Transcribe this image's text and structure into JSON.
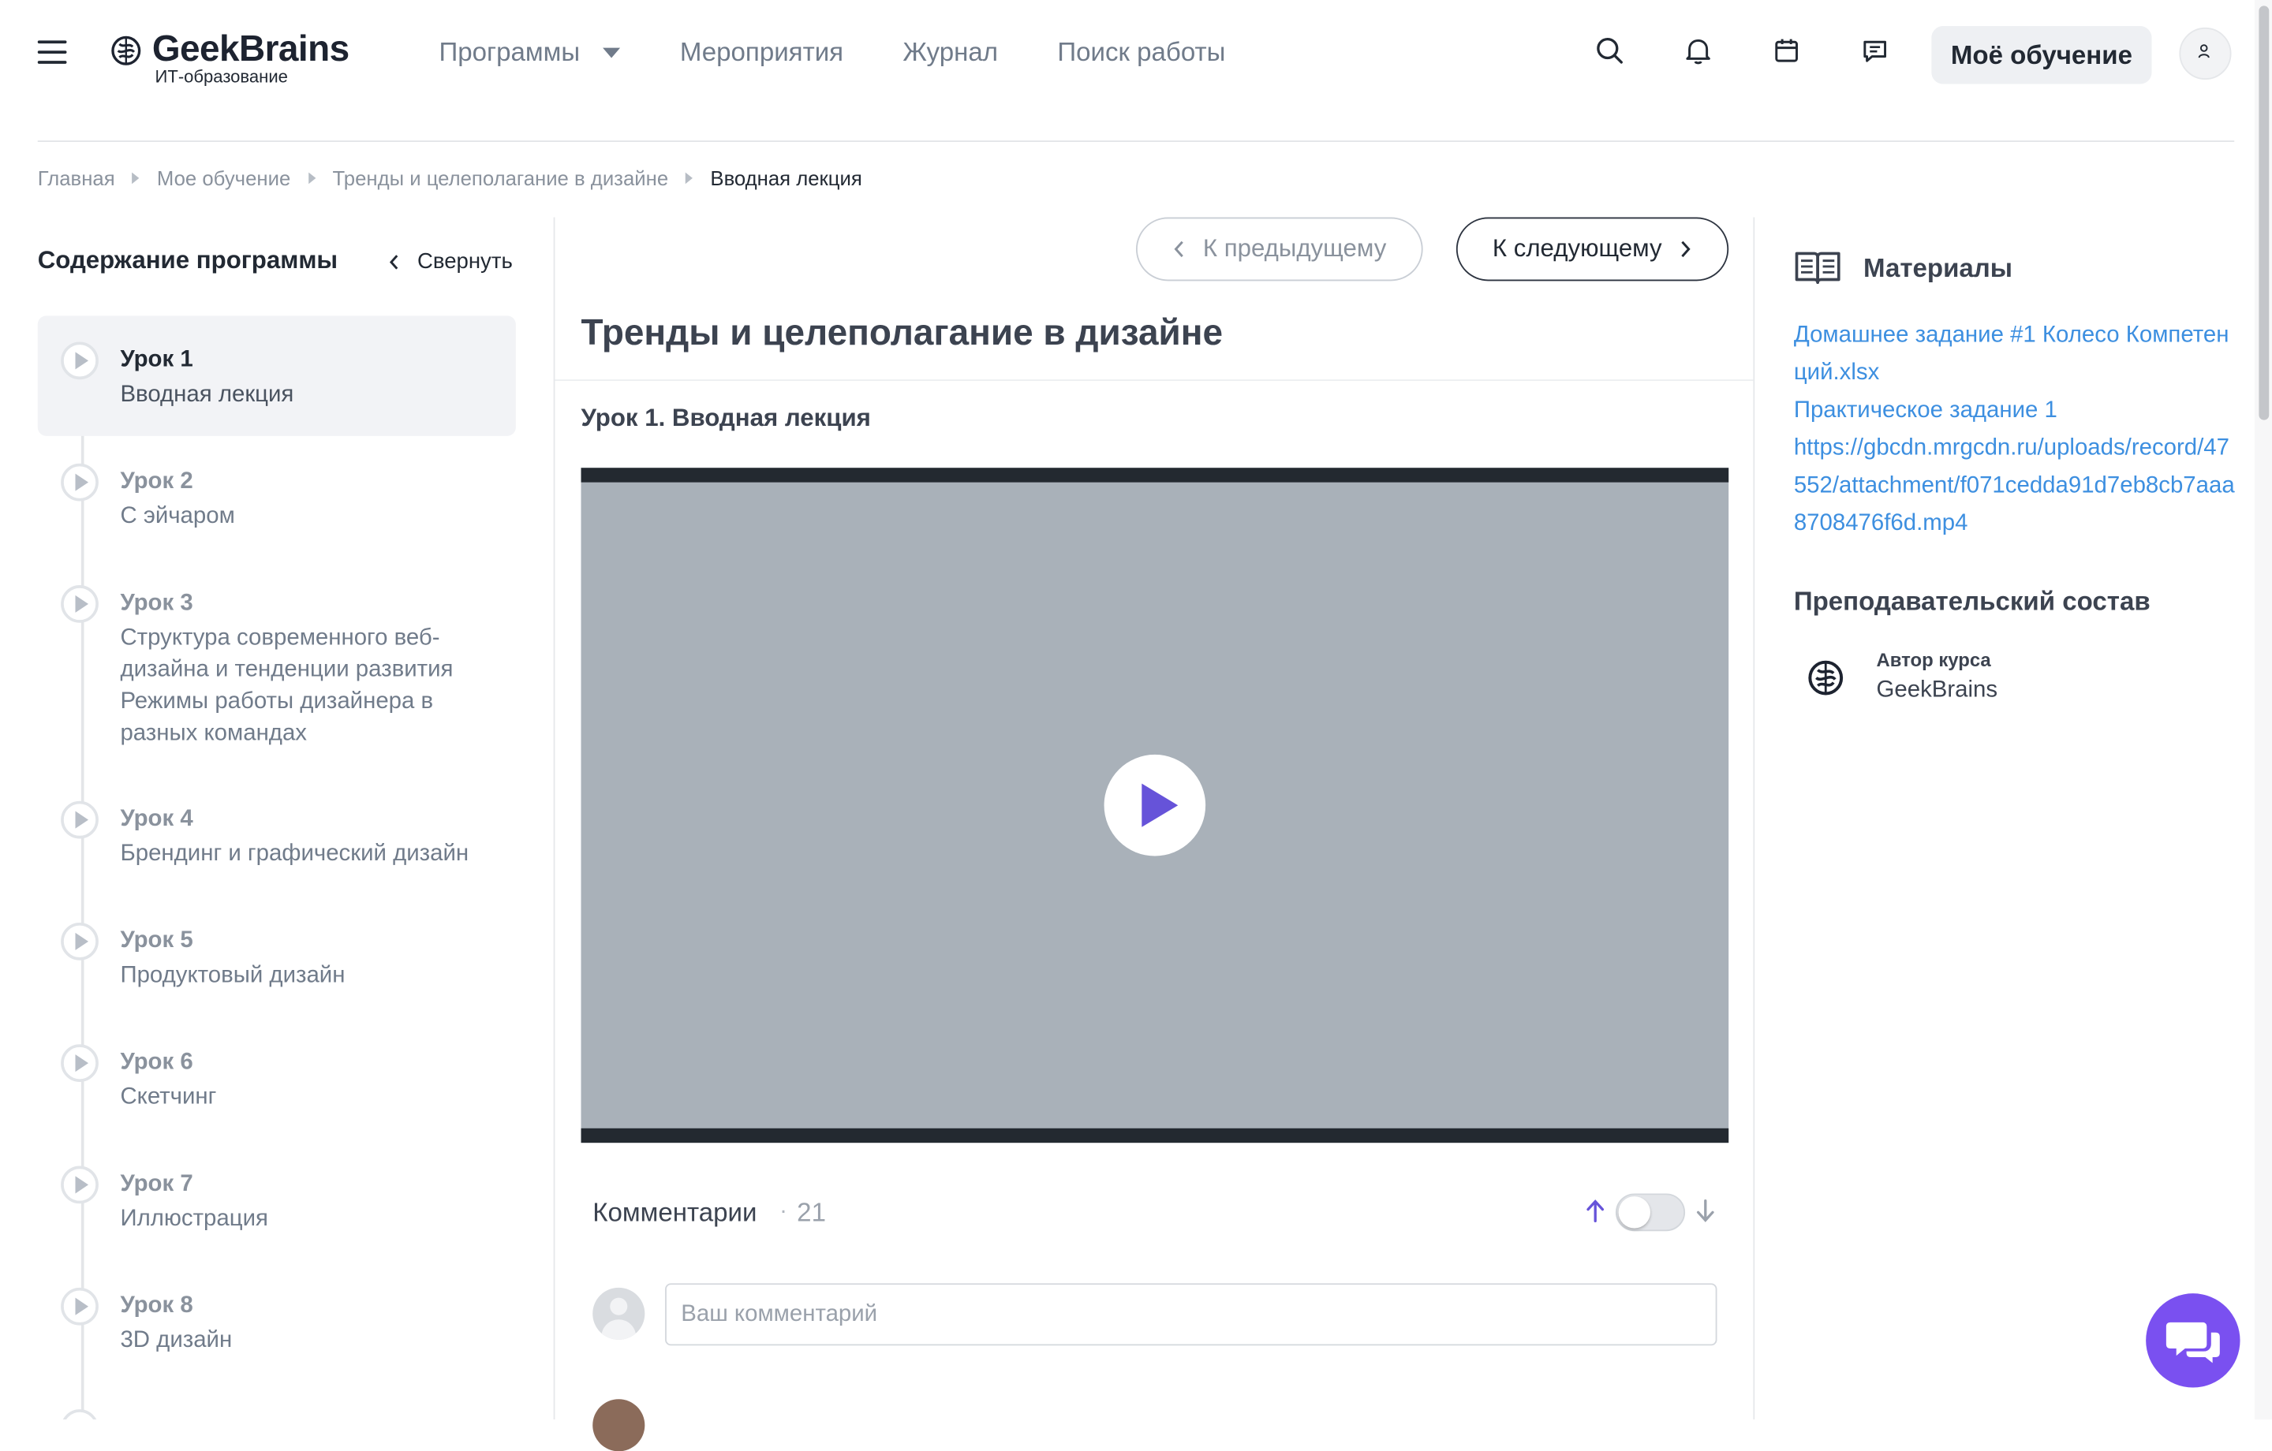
{
  "header": {
    "logo_name": "GeekBrains",
    "logo_sub": "ИТ-образование",
    "nav": [
      "Программы",
      "Мероприятия",
      "Журнал",
      "Поиск работы"
    ],
    "my_learning": "Моё обучение",
    "icons": [
      "menu-icon",
      "search-icon",
      "bell-icon",
      "calendar-icon",
      "chat-icon",
      "user-icon"
    ]
  },
  "breadcrumb": [
    "Главная",
    "Мое обучение",
    "Тренды и целеполагание в дизайне",
    "Вводная лекция"
  ],
  "sidebar": {
    "title": "Содержание программы",
    "collapse": "Свернуть",
    "lessons": [
      {
        "num": "Урок 1",
        "name": "Вводная лекция",
        "active": true
      },
      {
        "num": "Урок 2",
        "name": "С эйчаром"
      },
      {
        "num": "Урок 3",
        "name": "Структура современного веб-дизайна и тенденции развития Режимы работы дизайнера в разных командах"
      },
      {
        "num": "Урок 4",
        "name": "Брендинг и графический дизайн"
      },
      {
        "num": "Урок 5",
        "name": "Продуктовый дизайн"
      },
      {
        "num": "Урок 6",
        "name": "Скетчинг"
      },
      {
        "num": "Урок 7",
        "name": "Иллюстрация"
      },
      {
        "num": "Урок 8",
        "name": "3D дизайн"
      }
    ]
  },
  "main": {
    "prev": "К предыдущему",
    "next": "К следующему",
    "course_title": "Тренды и целеполагание в дизайне",
    "lesson_title": "Урок 1. Вводная лекция",
    "comments_label": "Комментарии",
    "comments_dot": "·",
    "comments_count": "21",
    "comment_placeholder": "Ваш комментарий"
  },
  "materials": {
    "title": "Материалы",
    "links": [
      "Домашнее задание #1 Колесо Компетенций.xlsx",
      "Практическое задание 1",
      "https://gbcdn.mrgcdn.ru/uploads/record/47552/attachment/f071cedda91d7eb8cb7aaa8708476f6d.mp4"
    ]
  },
  "staff": {
    "title": "Преподавательский состав",
    "role": "Автор курса",
    "name": "GeekBrains"
  },
  "colors": {
    "accent": "#7a50f0",
    "link": "#3d8fe0",
    "play": "#6653d9",
    "video_bg": "#a9b1b9"
  }
}
